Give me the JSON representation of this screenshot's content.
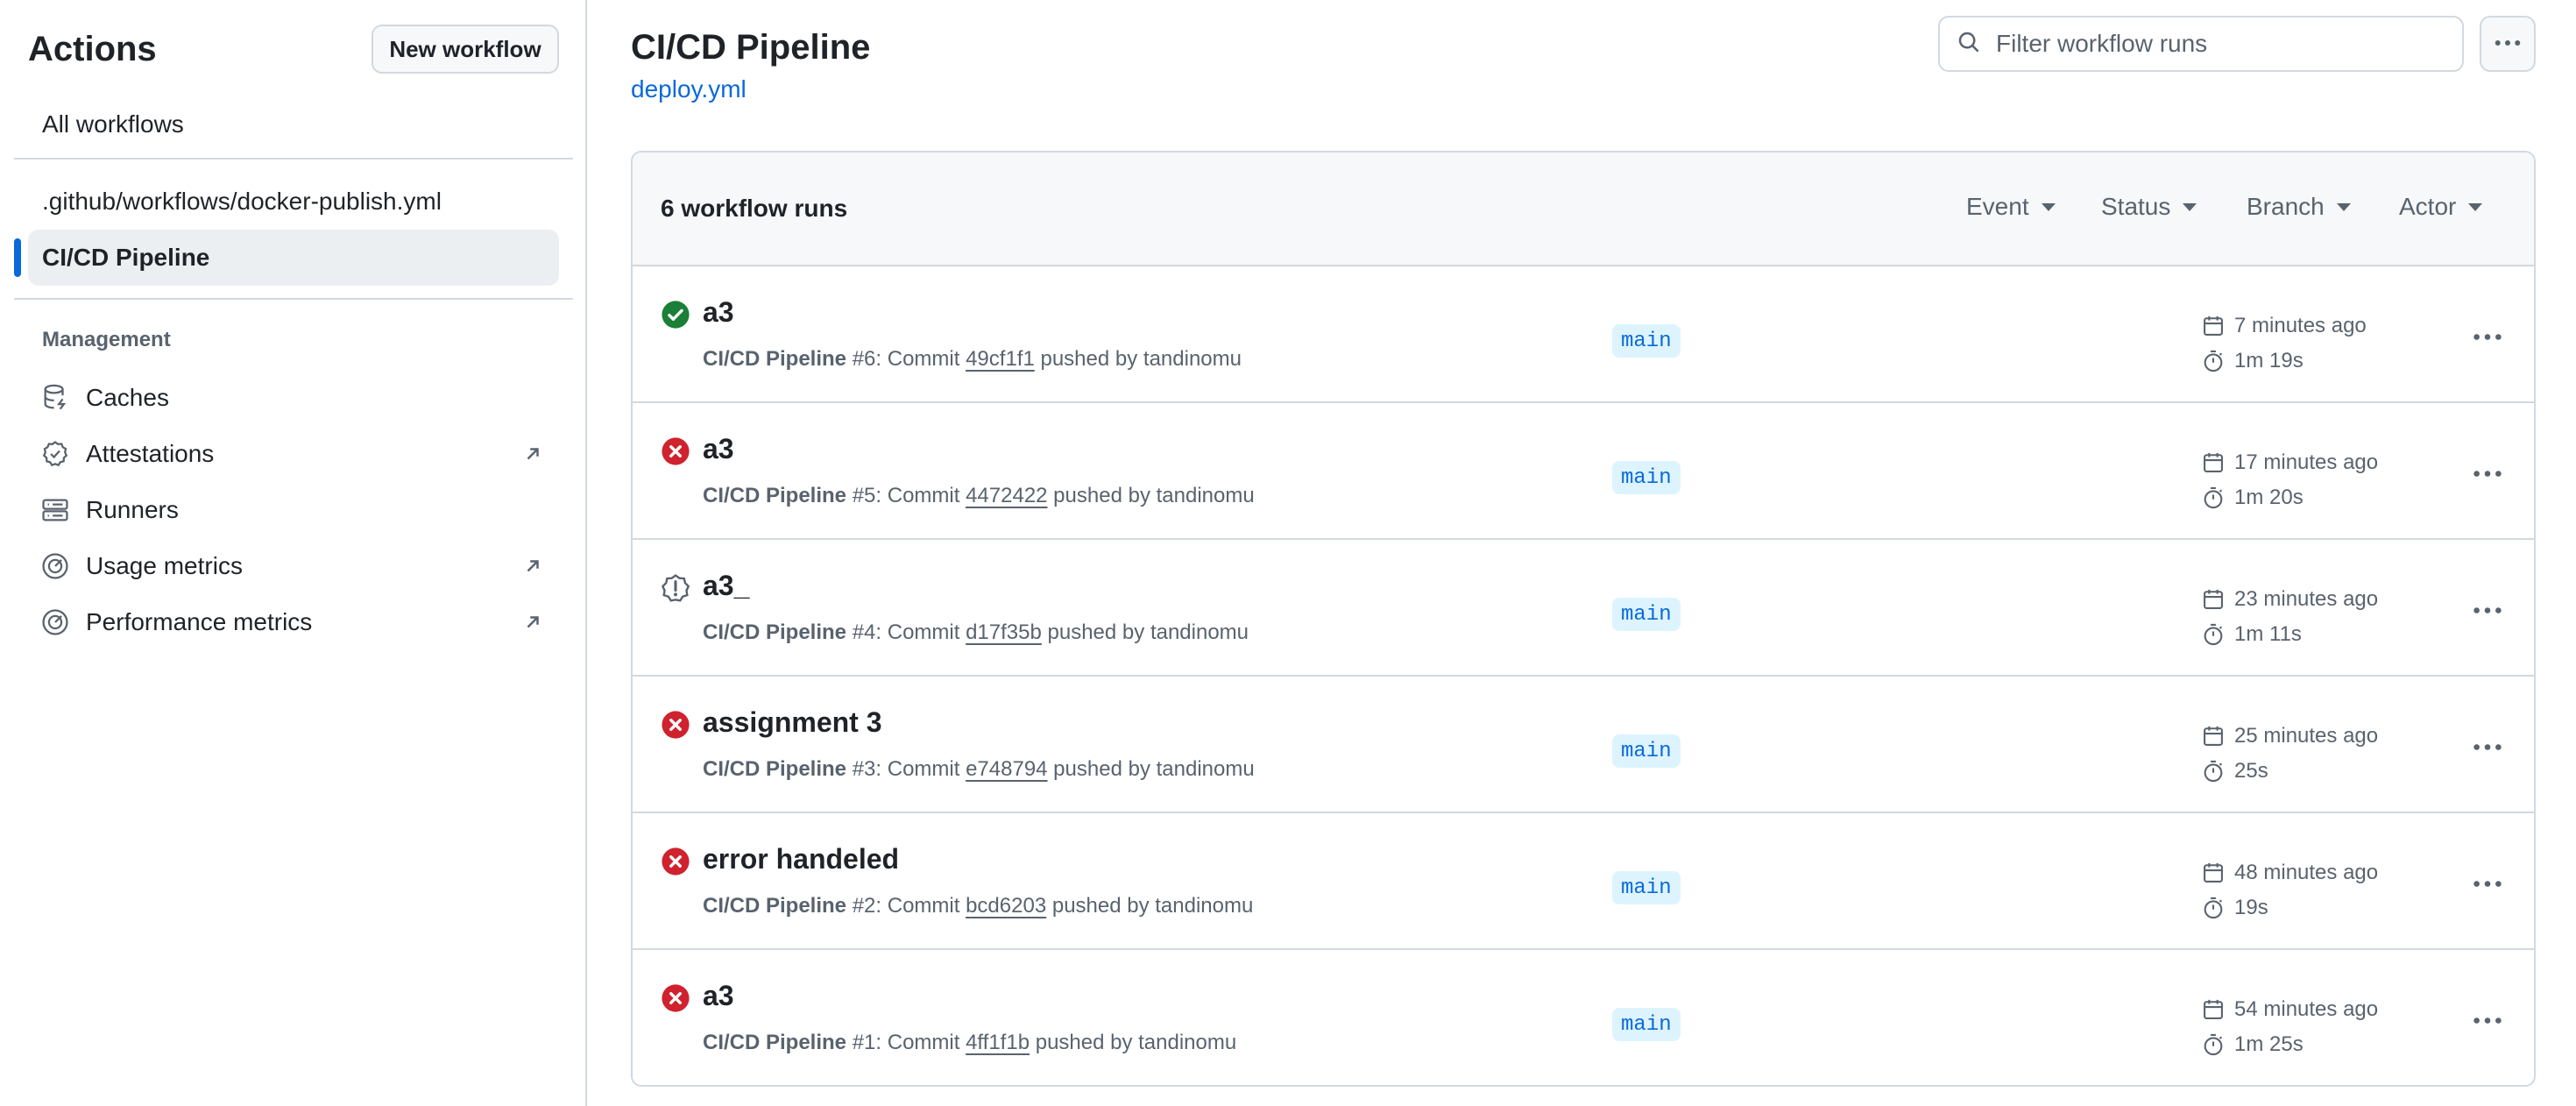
{
  "sidebar": {
    "title": "Actions",
    "new_workflow_label": "New workflow",
    "all_workflows_label": "All workflows",
    "workflows": [
      {
        "label": ".github/workflows/docker-publish.yml",
        "active": false
      },
      {
        "label": "CI/CD Pipeline",
        "active": true
      }
    ],
    "management_heading": "Management",
    "management": [
      {
        "label": "Caches",
        "icon": "database-icon",
        "external": false
      },
      {
        "label": "Attestations",
        "icon": "verified-icon",
        "external": true
      },
      {
        "label": "Runners",
        "icon": "server-icon",
        "external": false
      },
      {
        "label": "Usage metrics",
        "icon": "meter-icon",
        "external": true
      },
      {
        "label": "Performance metrics",
        "icon": "meter-icon",
        "external": true
      }
    ]
  },
  "header": {
    "title": "CI/CD Pipeline",
    "file_link": "deploy.yml",
    "filter_placeholder": "Filter workflow runs"
  },
  "runs": {
    "count_label": "6 workflow runs",
    "filters": [
      "Event",
      "Status",
      "Branch",
      "Actor"
    ],
    "items": [
      {
        "status": "success",
        "title": "a3",
        "workflow": "CI/CD Pipeline",
        "number": "#6",
        "commit": "49cf1f1",
        "actor": "tandinomu",
        "branch": "main",
        "when": "7 minutes ago",
        "duration": "1m 19s"
      },
      {
        "status": "failure",
        "title": "a3",
        "workflow": "CI/CD Pipeline",
        "number": "#5",
        "commit": "4472422",
        "actor": "tandinomu",
        "branch": "main",
        "when": "17 minutes ago",
        "duration": "1m 20s"
      },
      {
        "status": "warning",
        "title": "a3_",
        "workflow": "CI/CD Pipeline",
        "number": "#4",
        "commit": "d17f35b",
        "actor": "tandinomu",
        "branch": "main",
        "when": "23 minutes ago",
        "duration": "1m 11s"
      },
      {
        "status": "failure",
        "title": "assignment 3",
        "workflow": "CI/CD Pipeline",
        "number": "#3",
        "commit": "e748794",
        "actor": "tandinomu",
        "branch": "main",
        "when": "25 minutes ago",
        "duration": "25s"
      },
      {
        "status": "failure",
        "title": "error handeled",
        "workflow": "CI/CD Pipeline",
        "number": "#2",
        "commit": "bcd6203",
        "actor": "tandinomu",
        "branch": "main",
        "when": "48 minutes ago",
        "duration": "19s"
      },
      {
        "status": "failure",
        "title": "a3",
        "workflow": "CI/CD Pipeline",
        "number": "#1",
        "commit": "4ff1f1b",
        "actor": "tandinomu",
        "branch": "main",
        "when": "54 minutes ago",
        "duration": "1m 25s"
      }
    ]
  },
  "colors": {
    "accent": "#0969da",
    "success": "#1a7f37",
    "failure": "#cf222e",
    "muted": "#59636e",
    "border": "#d1d9e0"
  }
}
